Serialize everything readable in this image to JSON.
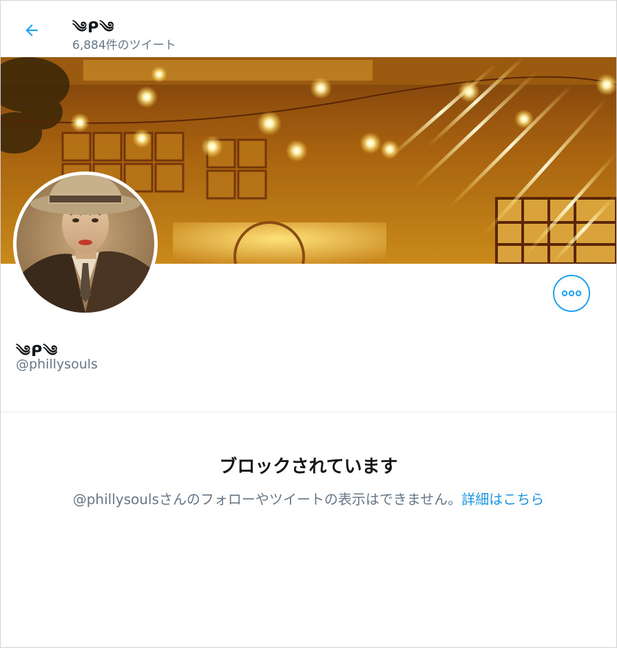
{
  "header": {
    "display_name": "༄ᑭ༄",
    "tweet_count": "6,884件のツイート"
  },
  "profile": {
    "display_name": "༄ᑭ༄",
    "handle": "@phillysouls"
  },
  "blocked": {
    "title": "ブロックされています",
    "message": "@phillysoulsさんのフォローやツイートの表示はできません。",
    "link": "詳細はこちら"
  },
  "icons": {
    "back": "arrow-left-icon",
    "more": "more-horizontal-icon"
  },
  "colors": {
    "accent": "#1da1f2",
    "link": "#1b95e0",
    "text_primary": "#14171a",
    "text_secondary": "#657786"
  }
}
